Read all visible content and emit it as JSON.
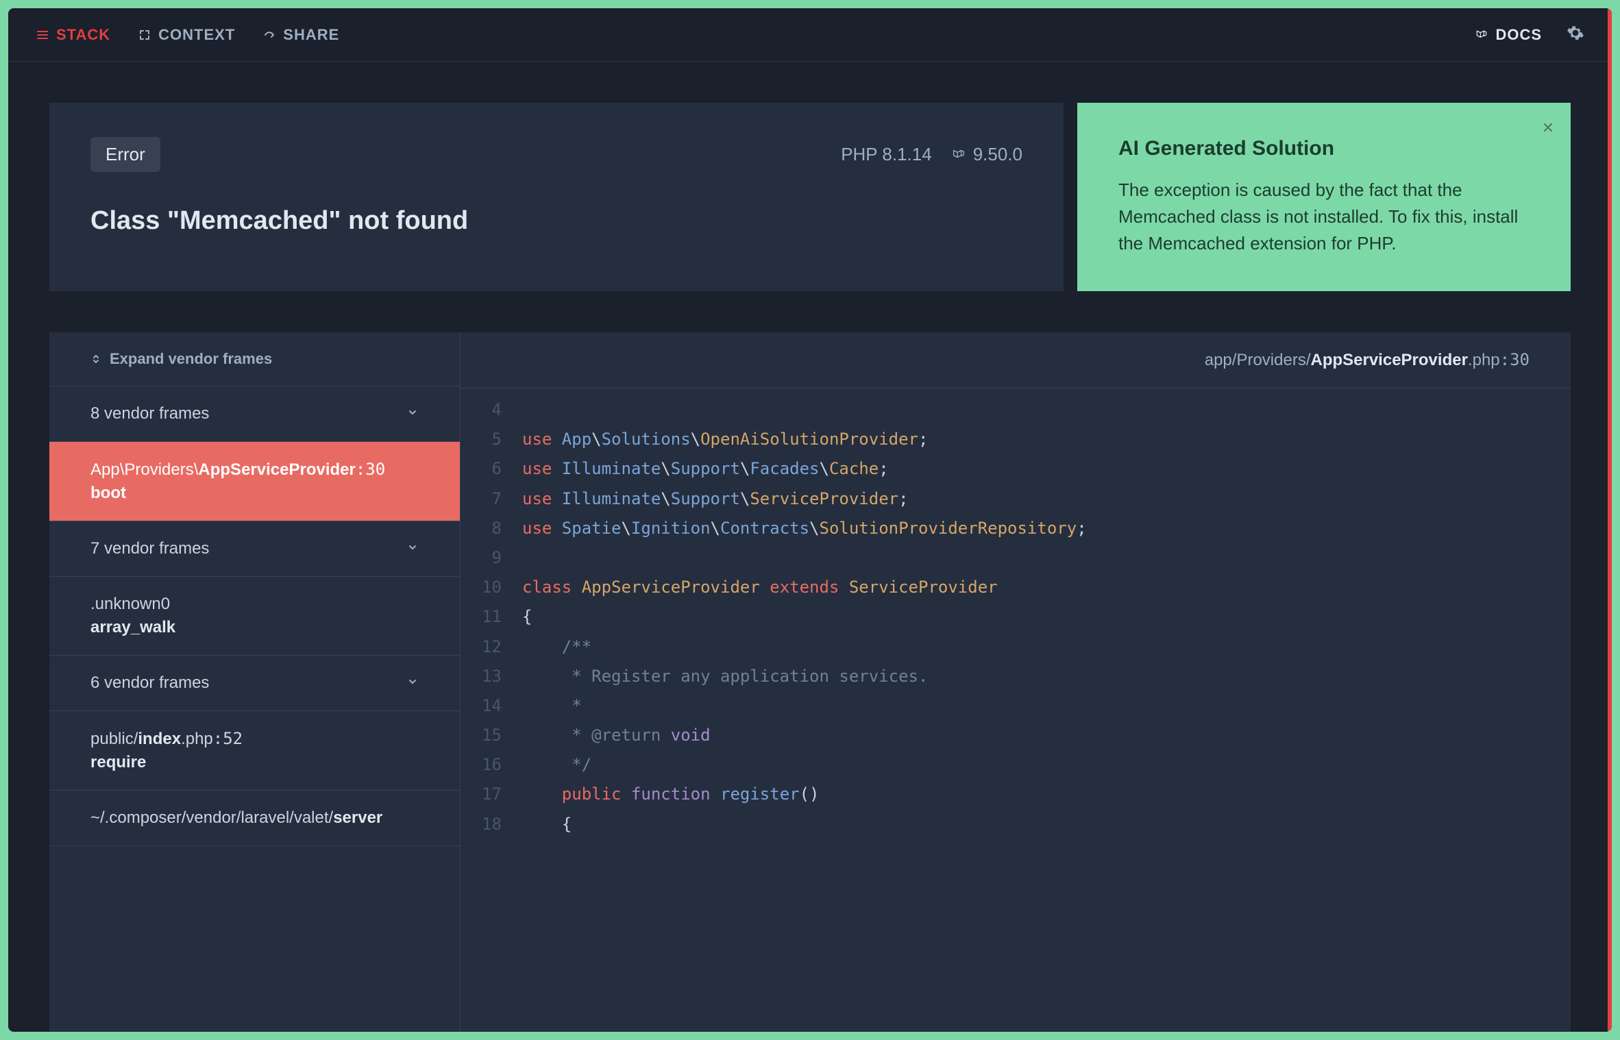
{
  "nav": {
    "stack": "STACK",
    "context": "CONTEXT",
    "share": "SHARE",
    "docs": "DOCS"
  },
  "error": {
    "badge": "Error",
    "php_version": "PHP 8.1.14",
    "laravel_version": "9.50.0",
    "message": "Class \"Memcached\" not found"
  },
  "solution": {
    "title": "AI Generated Solution",
    "text": "The exception is caused by the fact that the Memcached class is not installed. To fix this, install the Memcached extension for PHP."
  },
  "frames": {
    "expand_label": "Expand vendor frames",
    "items": [
      {
        "label": "8 vendor frames",
        "type": "group"
      },
      {
        "path_prefix": "App\\Providers\\",
        "path_file": "AppServiceProvider",
        "line": ":30",
        "method": "boot",
        "type": "active"
      },
      {
        "label": "7 vendor frames",
        "type": "group"
      },
      {
        "path": ".unknown0",
        "method": "array_walk",
        "type": "frame"
      },
      {
        "label": "6 vendor frames",
        "type": "group"
      },
      {
        "path_prefix": "public/",
        "path_file": "index",
        "path_suffix": ".php",
        "line": ":52",
        "method": "require",
        "type": "frame"
      },
      {
        "path_prefix": "~/.composer/vendor/laravel/valet/",
        "path_file": "server",
        "type": "frame_partial"
      }
    ]
  },
  "code": {
    "path_prefix": "app/Providers/",
    "file_name": "AppServiceProvider",
    "file_suffix": ".php",
    "line": ":30",
    "lines": [
      {
        "n": 4,
        "t": ""
      },
      {
        "n": 5,
        "t": "use App\\Solutions\\OpenAiSolutionProvider;",
        "tokens": [
          [
            "kw",
            "use "
          ],
          [
            "ns",
            "App"
          ],
          [
            "",
            "\\"
          ],
          [
            "ns",
            "Solutions"
          ],
          [
            "",
            "\\"
          ],
          [
            "cls",
            "OpenAiSolutionProvider"
          ],
          [
            "",
            ";"
          ]
        ]
      },
      {
        "n": 6,
        "t": "use Illuminate\\Support\\Facades\\Cache;",
        "tokens": [
          [
            "kw",
            "use "
          ],
          [
            "ns",
            "Illuminate"
          ],
          [
            "",
            "\\"
          ],
          [
            "ns",
            "Support"
          ],
          [
            "",
            "\\"
          ],
          [
            "ns",
            "Facades"
          ],
          [
            "",
            "\\"
          ],
          [
            "cls",
            "Cache"
          ],
          [
            "",
            ";"
          ]
        ]
      },
      {
        "n": 7,
        "t": "use Illuminate\\Support\\ServiceProvider;",
        "tokens": [
          [
            "kw",
            "use "
          ],
          [
            "ns",
            "Illuminate"
          ],
          [
            "",
            "\\"
          ],
          [
            "ns",
            "Support"
          ],
          [
            "",
            "\\"
          ],
          [
            "cls",
            "ServiceProvider"
          ],
          [
            "",
            ";"
          ]
        ]
      },
      {
        "n": 8,
        "t": "use Spatie\\Ignition\\Contracts\\SolutionProviderRepository;",
        "tokens": [
          [
            "kw",
            "use "
          ],
          [
            "ns",
            "Spatie"
          ],
          [
            "",
            "\\"
          ],
          [
            "ns",
            "Ignition"
          ],
          [
            "",
            "\\"
          ],
          [
            "ns",
            "Contracts"
          ],
          [
            "",
            "\\"
          ],
          [
            "cls",
            "SolutionProviderRepository"
          ],
          [
            "",
            ";"
          ]
        ]
      },
      {
        "n": 9,
        "t": ""
      },
      {
        "n": 10,
        "t": "class AppServiceProvider extends ServiceProvider",
        "tokens": [
          [
            "kw",
            "class "
          ],
          [
            "cls",
            "AppServiceProvider"
          ],
          [
            "",
            " "
          ],
          [
            "kw",
            "extends"
          ],
          [
            "",
            " "
          ],
          [
            "cls",
            "ServiceProvider"
          ]
        ]
      },
      {
        "n": 11,
        "t": "{",
        "tokens": [
          [
            "",
            "{"
          ]
        ]
      },
      {
        "n": 12,
        "t": "    /**",
        "tokens": [
          [
            "cmt",
            "    /**"
          ]
        ]
      },
      {
        "n": 13,
        "t": "     * Register any application services.",
        "tokens": [
          [
            "cmt",
            "     * Register any application services."
          ]
        ]
      },
      {
        "n": 14,
        "t": "     *",
        "tokens": [
          [
            "cmt",
            "     *"
          ]
        ]
      },
      {
        "n": 15,
        "t": "     * @return void",
        "tokens": [
          [
            "cmt",
            "     * @return "
          ],
          [
            "fn",
            "void"
          ]
        ]
      },
      {
        "n": 16,
        "t": "     */",
        "tokens": [
          [
            "cmt",
            "     */"
          ]
        ]
      },
      {
        "n": 17,
        "t": "    public function register()",
        "tokens": [
          [
            "",
            "    "
          ],
          [
            "kw",
            "public"
          ],
          [
            "",
            " "
          ],
          [
            "fn",
            "function"
          ],
          [
            "",
            " "
          ],
          [
            "fname",
            "register"
          ],
          [
            "",
            "()"
          ]
        ]
      },
      {
        "n": 18,
        "t": "    {",
        "tokens": [
          [
            "",
            "    {"
          ]
        ]
      }
    ]
  }
}
